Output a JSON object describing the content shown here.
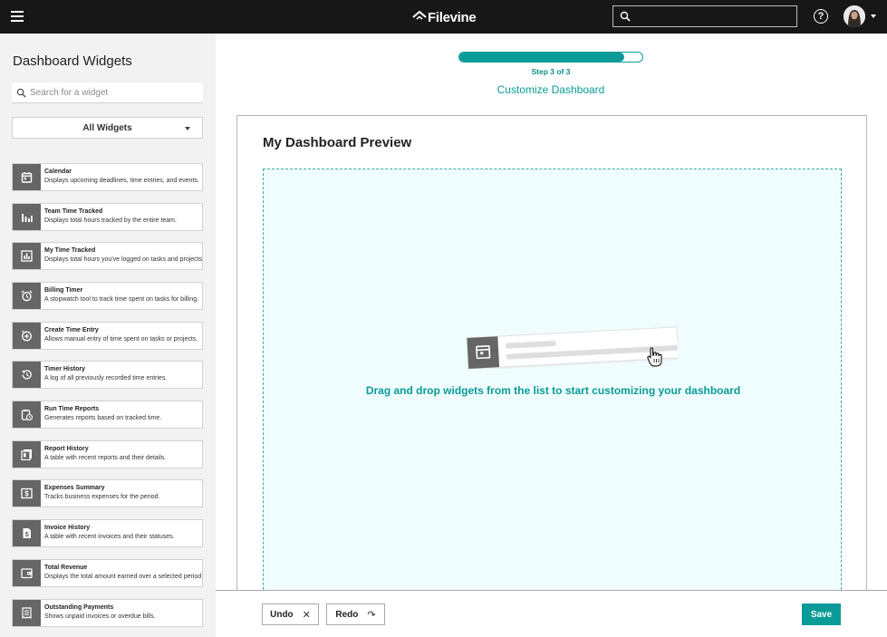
{
  "header": {
    "brand": "Filevine",
    "menu_icon": "hamburger-menu-icon",
    "search_icon": "search-icon",
    "help_icon": "help-circle-icon",
    "avatar_icon": "user-avatar"
  },
  "sidebar": {
    "title": "Dashboard Widgets",
    "search_placeholder": "Search for a widget",
    "filter_selected": "All Widgets",
    "widgets": [
      {
        "name": "Calendar",
        "description": "Displays upcoming deadlines, time entries, and events.",
        "icon": "calendar-icon"
      },
      {
        "name": "Team Time Tracked",
        "description": "Displays total hours tracked by the entire team.",
        "icon": "team-bar-chart-icon"
      },
      {
        "name": "My Time Tracked",
        "description": "Displays total hours you've logged on tasks and projects.",
        "icon": "bar-chart-icon"
      },
      {
        "name": "Billing Timer",
        "description": "A stopwatch tool to track time spent on tasks for billing.",
        "icon": "alarm-clock-icon"
      },
      {
        "name": "Create Time Entry",
        "description": "Allows manual entry of time spent on tasks or projects.",
        "icon": "add-time-icon"
      },
      {
        "name": "Timer History",
        "description": "A log of all previously recorded time entries.",
        "icon": "history-icon"
      },
      {
        "name": "Run Time Reports",
        "description": "Generates reports based on tracked time.",
        "icon": "clipboard-clock-icon"
      },
      {
        "name": "Report History",
        "description": "A table with recent reports and their details.",
        "icon": "report-stack-icon"
      },
      {
        "name": "Expenses Summary",
        "description": "Tracks business expenses for the period.",
        "icon": "dollar-box-icon"
      },
      {
        "name": "Invoice History",
        "description": "A table with recent invoices and their statuses.",
        "icon": "invoice-dollar-icon"
      },
      {
        "name": "Total Revenue",
        "description": "Displays the total amount earned over a selected period.",
        "icon": "wallet-icon"
      },
      {
        "name": "Outstanding Payments",
        "description": "Shows unpaid invoices or overdue bills.",
        "icon": "receipt-icon"
      }
    ]
  },
  "wizard": {
    "step_label": "Step 3 of 3",
    "progress": 0.9,
    "subtitle": "Customize Dashboard"
  },
  "preview": {
    "title": "My Dashboard Preview",
    "dropzone_message": "Drag and drop widgets from the list to start customizing your dashboard"
  },
  "footer": {
    "undo_label": "Undo",
    "redo_label": "Redo",
    "save_label": "Save"
  },
  "colors": {
    "accent": "#0a9b97",
    "topbar": "#171717",
    "sidebar_bg": "#f2f2f2",
    "icon_tile": "#666666",
    "dropzone_bg": "#f0fdfe"
  }
}
